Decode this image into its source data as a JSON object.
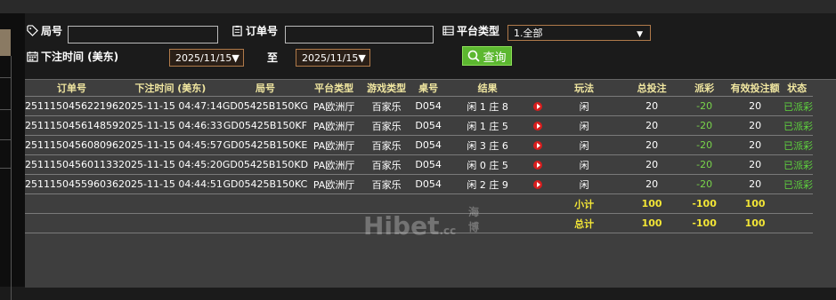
{
  "filters": {
    "round_label": "局号",
    "order_label": "订单号",
    "platform_label": "平台类型",
    "platform_value": "1.全部",
    "bet_time_label": "下注时间 (美东)",
    "date_from": "2025/11/15▼",
    "date_to_label": "至",
    "date_to": "2025/11/15▼",
    "query_button": "查询"
  },
  "table": {
    "headers": [
      "订单号",
      "下注时间 (美东)",
      "局号",
      "平台类型",
      "游戏类型",
      "桌号",
      "结果",
      "",
      "玩法",
      "总投注",
      "派彩",
      "有效投注额",
      "状态"
    ],
    "rows": [
      {
        "order": "251115045622196",
        "time": "2025-11-15 04:47:14",
        "round": "GD05425B150KG",
        "platform": "PA欧洲厅",
        "game": "百家乐",
        "table": "D054",
        "result": "闲 1 庄 8",
        "play": "闲",
        "bet": "20",
        "payout": "-20",
        "valid": "20",
        "status": "已派彩"
      },
      {
        "order": "251115045614859",
        "time": "2025-11-15 04:46:33",
        "round": "GD05425B150KF",
        "platform": "PA欧洲厅",
        "game": "百家乐",
        "table": "D054",
        "result": "闲 1 庄 5",
        "play": "闲",
        "bet": "20",
        "payout": "-20",
        "valid": "20",
        "status": "已派彩"
      },
      {
        "order": "251115045608096",
        "time": "2025-11-15 04:45:57",
        "round": "GD05425B150KE",
        "platform": "PA欧洲厅",
        "game": "百家乐",
        "table": "D054",
        "result": "闲 3 庄 6",
        "play": "闲",
        "bet": "20",
        "payout": "-20",
        "valid": "20",
        "status": "已派彩"
      },
      {
        "order": "251115045601133",
        "time": "2025-11-15 04:45:20",
        "round": "GD05425B150KD",
        "platform": "PA欧洲厅",
        "game": "百家乐",
        "table": "D054",
        "result": "闲 0 庄 5",
        "play": "闲",
        "bet": "20",
        "payout": "-20",
        "valid": "20",
        "status": "已派彩"
      },
      {
        "order": "251115045596036",
        "time": "2025-11-15 04:44:51",
        "round": "GD05425B150KC",
        "platform": "PA欧洲厅",
        "game": "百家乐",
        "table": "D054",
        "result": "闲 2 庄 9",
        "play": "闲",
        "bet": "20",
        "payout": "-20",
        "valid": "20",
        "status": "已派彩"
      }
    ],
    "subtotal": {
      "label": "小计",
      "bet": "100",
      "payout": "-100",
      "valid": "100"
    },
    "total": {
      "label": "总计",
      "bet": "100",
      "payout": "-100",
      "valid": "100"
    }
  },
  "watermark": {
    "main": "Hibet",
    "suffix": ".cc",
    "small": "海博"
  },
  "colors": {
    "accent": "#5cb830",
    "header_text": "#f0e6a0",
    "negative": "#79d44b",
    "status": "#5fd33e",
    "sum": "#f2e536",
    "play_icon": "#d81e1e"
  },
  "icons": {
    "round": "tag-icon",
    "order": "clipboard-icon",
    "platform": "list-icon",
    "bet_time": "calendar-icon",
    "query": "search-icon",
    "result": "play-video-icon"
  }
}
